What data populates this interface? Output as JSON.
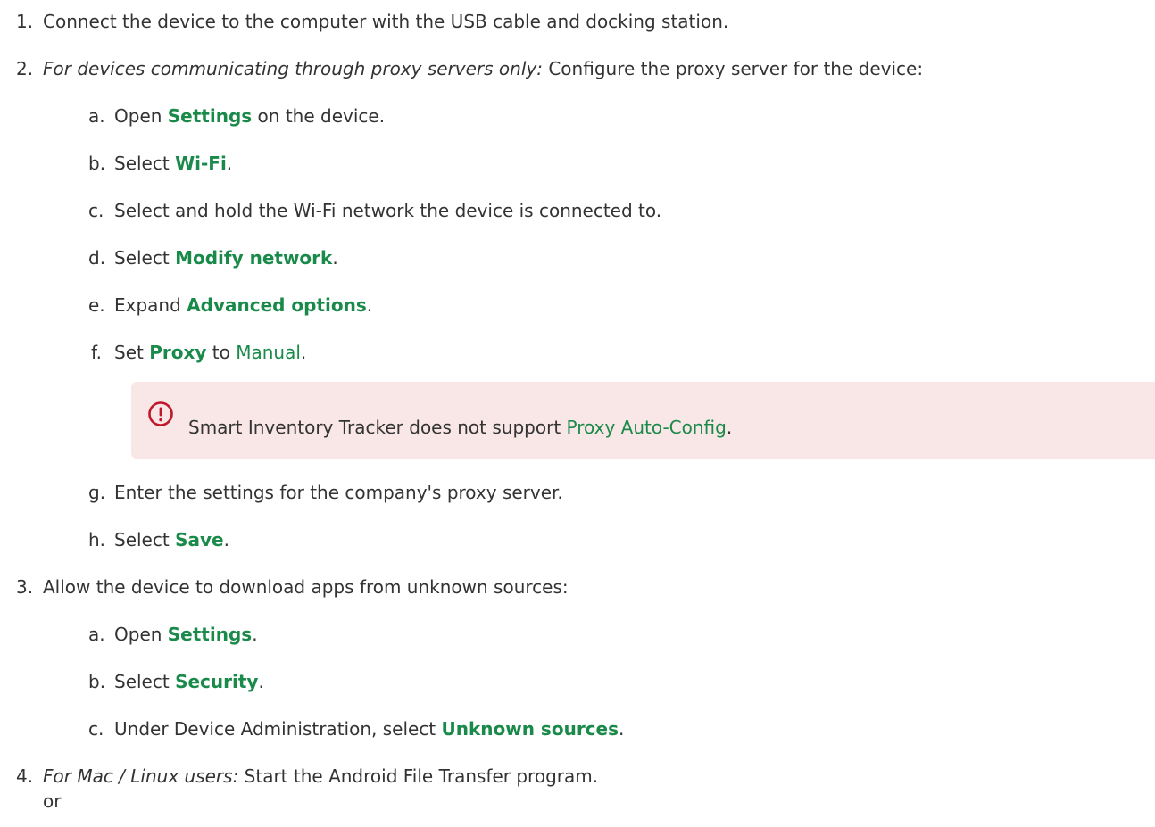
{
  "step1": {
    "num": "1.",
    "text": "Connect the device to the computer with the USB cable and docking station."
  },
  "step2": {
    "num": "2.",
    "qualifier": "For devices communicating through proxy servers only:",
    "text": " Configure the proxy server for the device:",
    "a": {
      "num": "a.",
      "pre": "Open ",
      "ui": "Settings",
      "post": " on the device."
    },
    "b": {
      "num": "b.",
      "pre": "Select ",
      "ui": "Wi-Fi",
      "post": "."
    },
    "c": {
      "num": "c.",
      "text": "Select and hold the Wi-Fi network the device is connected to."
    },
    "d": {
      "num": "d.",
      "pre": "Select ",
      "ui": "Modify network",
      "post": "."
    },
    "e": {
      "num": "e.",
      "pre": "Expand ",
      "ui": "Advanced options",
      "post": "."
    },
    "f": {
      "num": "f.",
      "pre": "Set ",
      "ui": "Proxy",
      "mid": " to ",
      "value": "Manual",
      "post": "."
    },
    "note": {
      "icon": "warning-circle-icon",
      "pre": "Smart Inventory Tracker does not support ",
      "link": "Proxy Auto-Config",
      "post": "."
    },
    "g": {
      "num": "g.",
      "text": "Enter the settings for the company's proxy server."
    },
    "h": {
      "num": "h.",
      "pre": "Select ",
      "ui": "Save",
      "post": "."
    }
  },
  "step3": {
    "num": "3.",
    "text": "Allow the device to download apps from unknown sources:",
    "a": {
      "num": "a.",
      "pre": "Open ",
      "ui": "Settings",
      "post": "."
    },
    "b": {
      "num": "b.",
      "pre": "Select ",
      "ui": "Security",
      "post": "."
    },
    "c": {
      "num": "c.",
      "pre": "Under Device Administration, select ",
      "ui": "Unknown sources",
      "post": "."
    }
  },
  "step4": {
    "num": "4.",
    "qualifier": "For Mac / Linux users:",
    "text": " Start the Android File Transfer program.",
    "or": "or"
  },
  "colors": {
    "accent": "#1a8a4a",
    "note_bg": "#f9e6e6",
    "warning": "#c0182a"
  }
}
